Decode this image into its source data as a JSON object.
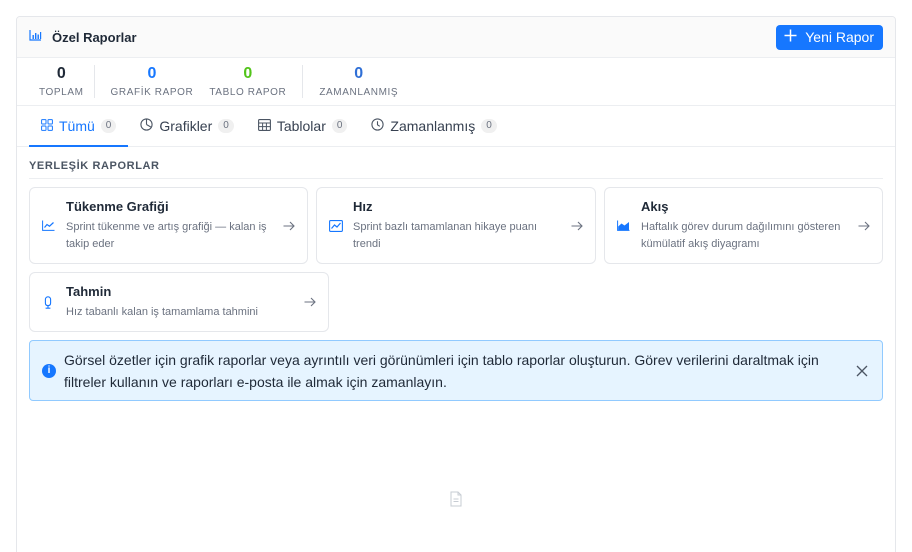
{
  "header": {
    "title": "Özel Raporlar",
    "new_report_label": "Yeni Rapor"
  },
  "stats": [
    {
      "value": "0",
      "label": "TOPLAM",
      "color": "#1f2937"
    },
    {
      "value": "0",
      "label": "GRAFİK RAPOR",
      "color": "#1677ff"
    },
    {
      "value": "0",
      "label": "TABLO RAPOR",
      "color": "#52c41a"
    },
    {
      "value": "0",
      "label": "ZAMANLANMIŞ",
      "color": "#2f6fd6"
    }
  ],
  "tabs": [
    {
      "label": "Tümü",
      "count": "0",
      "icon": "grid-icon",
      "active": true
    },
    {
      "label": "Grafikler",
      "count": "0",
      "icon": "pie-chart-icon"
    },
    {
      "label": "Tablolar",
      "count": "0",
      "icon": "table-icon"
    },
    {
      "label": "Zamanlanmış",
      "count": "0",
      "icon": "clock-icon"
    }
  ],
  "builtin": {
    "title": "YERLEŞİK RAPORLAR",
    "cards": [
      {
        "title": "Tükenme Grafiği",
        "desc": "Sprint tükenme ve artış grafiği — kalan iş takip eder",
        "icon": "line-chart-icon"
      },
      {
        "title": "Hız",
        "desc": "Sprint bazlı tamamlanan hikaye puanı trendi",
        "icon": "trend-chart-icon"
      },
      {
        "title": "Akış",
        "desc": "Haftalık görev durum dağılımını gösteren kümülatif akış diyagramı",
        "icon": "area-chart-icon"
      },
      {
        "title": "Tahmin",
        "desc": "Hız tabanlı kalan iş tamamlama tahmini",
        "icon": "forecast-icon"
      }
    ]
  },
  "alert": {
    "text": "Görsel özetler için grafik raporlar veya ayrıntılı veri görünümleri için tablo raporlar oluşturun. Görev verilerini daraltmak için filtreler kullanın ve raporları e-posta ile almak için zamanlayın."
  },
  "colors": {
    "accent": "#1677ff",
    "info_bg": "#e6f4ff",
    "info_border": "#91caff"
  }
}
